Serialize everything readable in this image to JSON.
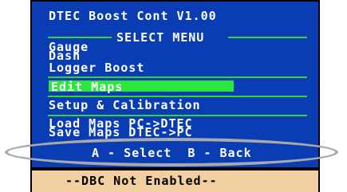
{
  "title": "DTEC Boost Cont V1.00",
  "section_header": "SELECT MENU",
  "menu_items": [
    "Gauge",
    "Dash",
    "Logger Boost",
    "Edit Maps",
    "Setup & Calibration",
    "Load Maps PC->DTEC",
    "Save Maps DTEC->PC"
  ],
  "selected_item": "Edit Maps",
  "controls_hint": "A - Select  B - Back",
  "status_message": "--DBC Not Enabled--",
  "colors": {
    "panel_bg": "#0a3cb4",
    "accent_green": "#33d433",
    "highlight_green": "#2ce63c",
    "footer_bg": "#f2cfa0",
    "annotation_gray": "#a9a9a9"
  }
}
